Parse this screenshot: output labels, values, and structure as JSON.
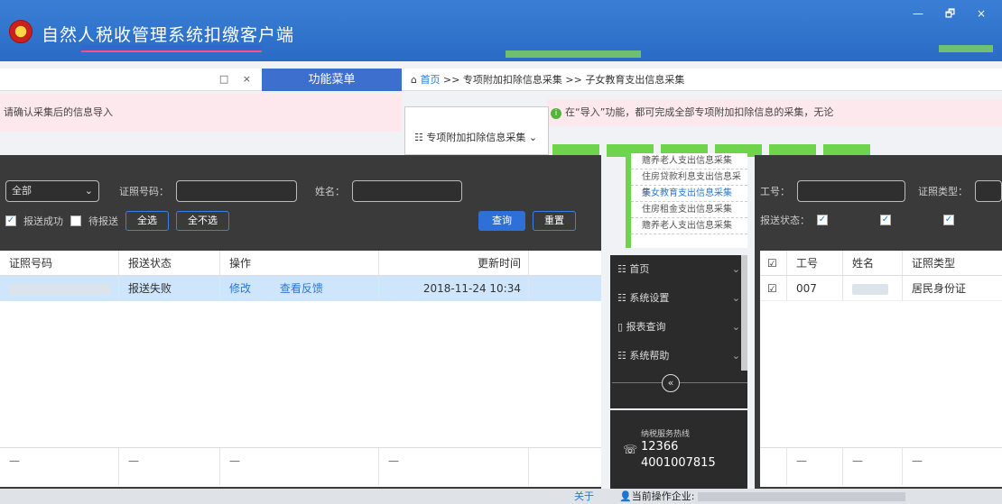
{
  "titlebar": {
    "app_title": "自然人税收管理系统扣缴客户端",
    "window_controls": "— 🗗 ×"
  },
  "tabs_bar": {
    "close_controls": "□ ×"
  },
  "function_menu": {
    "header": "功能菜单"
  },
  "breadcrumb": {
    "home": "首页",
    "path": ">> 专项附加扣除信息采集 >> 子女教育支出信息采集"
  },
  "notice": {
    "left": "请确认采集后的信息导入",
    "right": "在“导入”功能，都可完成全部专项附加扣除信息的采集，无论"
  },
  "menu_dropdown": {
    "collapsed_item": "专项附加扣除信息采集"
  },
  "menu_tree": {
    "items": [
      "赡养老人支出信息采集",
      "住房贷款利息支出信息采集",
      "子女教育支出信息采集",
      "住房租金支出信息采集",
      "赡养老人支出信息采集"
    ]
  },
  "left_filters": {
    "status_select": "全部",
    "id_label": "证照号码：",
    "name_label": "姓名：",
    "chk1_label": "报送成功",
    "chk2_label": "待报送",
    "select_all": "全选",
    "select_none": "全不选",
    "query": "查询",
    "reset": "重置"
  },
  "left_table": {
    "headers": [
      "证照号码",
      "报送状态",
      "操作",
      "更新时间"
    ],
    "row": {
      "status": "报送失败",
      "edit": "修改",
      "view_feedback": "查看反馈",
      "updated": "2018-11-24 10:34"
    },
    "footer": [
      "—",
      "—",
      "—",
      "—"
    ]
  },
  "side_menu": {
    "items": [
      {
        "label": "首页"
      },
      {
        "label": "系统设置"
      },
      {
        "label": "报表查询"
      },
      {
        "label": "系统帮助"
      }
    ],
    "collapse": "«"
  },
  "hotline": {
    "label": "纳税服务热线",
    "number1": "12366",
    "number2": "4001007815"
  },
  "right_filters": {
    "id_label": "工号：",
    "type_label": "证照类型：",
    "status_label": "报送状态："
  },
  "right_table": {
    "headers": [
      "☑",
      "工号",
      "姓名",
      "证照类型"
    ],
    "row": {
      "check": "☑",
      "id": "007",
      "name": "",
      "type": "居民身份证"
    },
    "footer": [
      "",
      "—",
      "—",
      "—"
    ]
  },
  "statusbar": {
    "about": "关于",
    "company_label": "当前操作企业:"
  }
}
